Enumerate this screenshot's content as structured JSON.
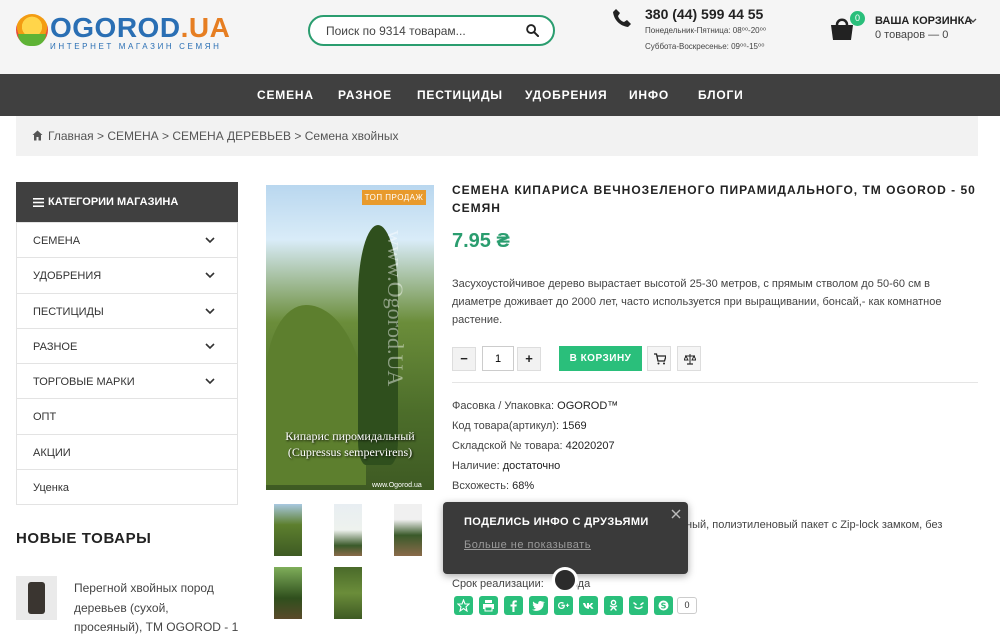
{
  "header": {
    "logo_main": "OGOROD",
    "logo_suffix": ".UA",
    "logo_sub": "ИНТЕРНЕТ МАГАЗИН СЕМЯН",
    "search_placeholder": "Поиск по 9314 товарам...",
    "phone": "380 (44) 599 44 55",
    "hours_weekdays": "Понедельник-Пятница: 08⁰⁰-20⁰⁰",
    "hours_weekend": "Суббота-Воскресенье: 09⁰⁰-15⁰⁰",
    "cart_count": "0",
    "cart_title": "ВАША КОРЗИНКА",
    "cart_summary": "0 товаров — 0"
  },
  "nav": {
    "items": [
      "СЕМЕНА",
      "РАЗНОЕ",
      "ПЕСТИЦИДЫ",
      "УДОБРЕНИЯ",
      "ИНФО",
      "БЛОГИ"
    ]
  },
  "breadcrumb": "Главная > СЕМЕНА > СЕМЕНА ДЕРЕВЬЕВ > Семена хвойных",
  "sidebar": {
    "title": "КАТЕГОРИИ МАГАЗИНА",
    "items": [
      {
        "label": "СЕМЕНА"
      },
      {
        "label": "УДОБРЕНИЯ"
      },
      {
        "label": "ПЕСТИЦИДЫ"
      },
      {
        "label": "РАЗНОЕ"
      },
      {
        "label": "ТОРГОВЫЕ МАРКИ"
      },
      {
        "label": "ОПТ"
      },
      {
        "label": "АКЦИИ"
      },
      {
        "label": "Уценка"
      }
    ],
    "new_title": "НОВЫЕ ТОВАРЫ",
    "new_item_text": "Перегной хвойных пород деревьев (сухой, просеяный), ТМ OGOROD - 1"
  },
  "product": {
    "badge": "ТОП ПРОДАЖ",
    "image_caption": "Кипарис пиромидальный (Cupressus sempervirens)",
    "image_watermark": "www.Ogorod.UA",
    "image_url": "www.Ogorod.ua",
    "title": "СЕМЕНА КИПАРИСА ВЕЧНОЗЕЛЕНОГО ПИРАМИДАЛЬНОГО, ТМ OGOROD - 50 СЕМЯН",
    "price": "7.95 ₴",
    "description": "Засухоустойчивое дерево вырастает высотой 25-30 метров, с прямым стволом до 50-60 см в диаметре доживает до 2000 лет, часто используется при выращивании, бонсай,- как комнатное растение.",
    "qty": "1",
    "qty_minus": "−",
    "qty_plus": "+",
    "add_to_cart": "В КОРЗИНУ",
    "attrs": [
      {
        "label": "Фасовка / Упаковка:",
        "value": "OGOROD™"
      },
      {
        "label": "Код товара(артикул):",
        "value": "1569"
      },
      {
        "label": "Складской № товара:",
        "value": "42020207"
      },
      {
        "label": "Наличие:",
        "value": "достаточно"
      },
      {
        "label": "Всхожесть:",
        "value": "68%"
      }
    ],
    "partial_pack": "ный, полиэтиленовый пакет с Zip-lock замком, без",
    "shelf_life_label": "Срок реализации:",
    "shelf_life_value": "года",
    "share_count": "0"
  },
  "share_popup": {
    "title": "ПОДЕЛИСЬ ИНФО С ДРУЗЬЯМИ",
    "dismiss": "Больше не показывать"
  },
  "colors": {
    "accent_green": "#2abf7b",
    "price_green": "#2a9d6f",
    "nav_bg": "#404040"
  }
}
